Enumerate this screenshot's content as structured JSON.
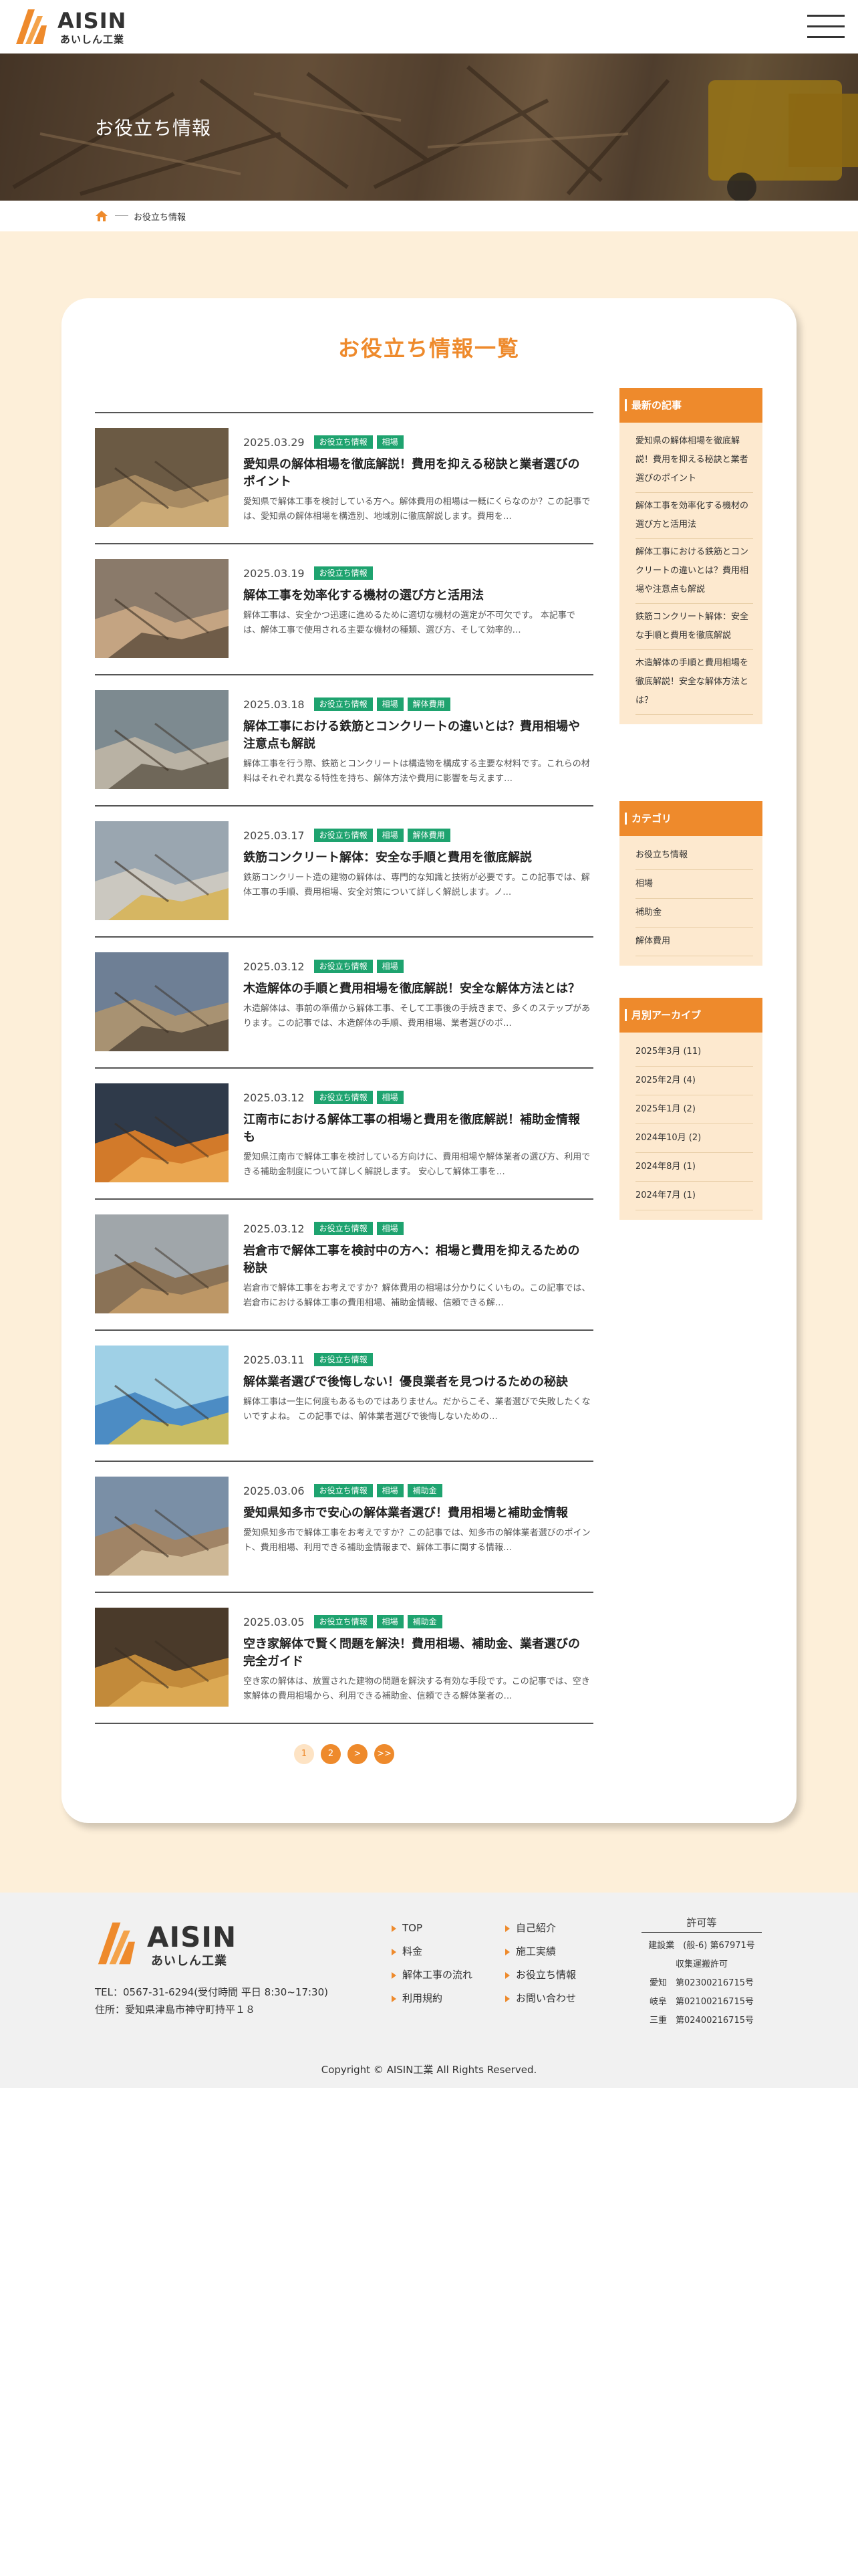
{
  "header": {
    "logo_en": "AISIN",
    "logo_jp": "あいしん工業"
  },
  "hero": {
    "title": "お役立ち情報"
  },
  "breadcrumb": {
    "current": "お役立ち情報"
  },
  "main": {
    "title": "お役立ち情報一覧",
    "articles": [
      {
        "date": "2025.03.29",
        "tags": [
          "お役立ち情報",
          "相場"
        ],
        "title": "愛知県の解体相場を徹底解説！費用を抑える秘訣と業者選びのポイント",
        "excerpt": "愛知県で解体工事を検討している方へ。解体費用の相場は一概にくらなのか？この記事では、愛知県の解体相場を構造別、地域別に徹底解説します。費用を…"
      },
      {
        "date": "2025.03.19",
        "tags": [
          "お役立ち情報"
        ],
        "title": "解体工事を効率化する機材の選び方と活用法",
        "excerpt": "解体工事は、安全かつ迅速に進めるために適切な機材の選定が不可欠です。 本記事では、解体工事で使用される主要な機材の種類、選び方、そして効率的…"
      },
      {
        "date": "2025.03.18",
        "tags": [
          "お役立ち情報",
          "相場",
          "解体費用"
        ],
        "title": "解体工事における鉄筋とコンクリートの違いとは？費用相場や注意点も解説",
        "excerpt": "解体工事を行う際、鉄筋とコンクリートは構造物を構成する主要な材料です。これらの材料はそれぞれ異なる特性を持ち、解体方法や費用に影響を与えます…"
      },
      {
        "date": "2025.03.17",
        "tags": [
          "お役立ち情報",
          "相場",
          "解体費用"
        ],
        "title": "鉄筋コンクリート解体：安全な手順と費用を徹底解説",
        "excerpt": "鉄筋コンクリート造の建物の解体は、専門的な知識と技術が必要です。この記事では、解体工事の手順、費用相場、安全対策について詳しく解説します。ノ…"
      },
      {
        "date": "2025.03.12",
        "tags": [
          "お役立ち情報",
          "相場"
        ],
        "title": "木造解体の手順と費用相場を徹底解説！安全な解体方法とは？",
        "excerpt": "木造解体は、事前の準備から解体工事、そして工事後の手続きまで、多くのステップがあります。この記事では、木造解体の手順、費用相場、業者選びのポ…"
      },
      {
        "date": "2025.03.12",
        "tags": [
          "お役立ち情報",
          "相場"
        ],
        "title": "江南市における解体工事の相場と費用を徹底解説！補助金情報も",
        "excerpt": "愛知県江南市で解体工事を検討している方向けに、費用相場や解体業者の選び方、利用できる補助金制度について詳しく解説します。 安心して解体工事を…"
      },
      {
        "date": "2025.03.12",
        "tags": [
          "お役立ち情報",
          "相場"
        ],
        "title": "岩倉市で解体工事を検討中の方へ：相場と費用を抑えるための秘訣",
        "excerpt": "岩倉市で解体工事をお考えですか？解体費用の相場は分かりにくいもの。この記事では、岩倉市における解体工事の費用相場、補助金情報、信頼できる解…"
      },
      {
        "date": "2025.03.11",
        "tags": [
          "お役立ち情報"
        ],
        "title": "解体業者選びで後悔しない！優良業者を見つけるための秘訣",
        "excerpt": "解体工事は一生に何度もあるものではありません。だからこそ、業者選びで失敗したくないですよね。 この記事では、解体業者選びで後悔しないための…"
      },
      {
        "date": "2025.03.06",
        "tags": [
          "お役立ち情報",
          "相場",
          "補助金"
        ],
        "title": "愛知県知多市で安心の解体業者選び！費用相場と補助金情報",
        "excerpt": "愛知県知多市で解体工事をお考えですか？この記事では、知多市の解体業者選びのポイント、費用相場、利用できる補助金情報まで、解体工事に関する情報…"
      },
      {
        "date": "2025.03.05",
        "tags": [
          "お役立ち情報",
          "相場",
          "補助金"
        ],
        "title": "空き家解体で賢く問題を解決！費用相場、補助金、業者選びの完全ガイド",
        "excerpt": "空き家の解体は、放置された建物の問題を解決する有効な手段です。この記事では、空き家解体の費用相場から、利用できる補助金、信頼できる解体業者の…"
      }
    ],
    "pagination": [
      "1",
      "2",
      ">",
      ">>"
    ]
  },
  "sidebar": {
    "recent_title": "最新の記事",
    "recent": [
      "愛知県の解体相場を徹底解説！費用を抑える秘訣と業者選びのポイント",
      "解体工事を効率化する機材の選び方と活用法",
      "解体工事における鉄筋とコンクリートの違いとは？費用相場や注意点も解説",
      "鉄筋コンクリート解体：安全な手順と費用を徹底解説",
      "木造解体の手順と費用相場を徹底解説！安全な解体方法とは？"
    ],
    "category_title": "カテゴリ",
    "categories": [
      "お役立ち情報",
      "相場",
      "補助金",
      "解体費用"
    ],
    "archive_title": "月別アーカイブ",
    "archives": [
      "2025年3月 (11)",
      "2025年2月 (4)",
      "2025年1月 (2)",
      "2024年10月 (2)",
      "2024年8月 (1)",
      "2024年7月 (1)"
    ]
  },
  "footer": {
    "logo_en": "AISIN",
    "logo_jp": "あいしん工業",
    "tel": "TEL：0567-31-6294(受付時間 平日 8:30~17:30)",
    "address": "住所：愛知県津島市神守町持平１８",
    "nav_col1": [
      "TOP",
      "料金",
      "解体工事の流れ",
      "利用規約"
    ],
    "nav_col2": [
      "自己紹介",
      "施工実績",
      "お役立ち情報",
      "お問い合わせ"
    ],
    "license_title": "許可等",
    "license_lines": [
      "建設業　(般-6) 第67971号",
      "収集運搬許可",
      "愛知　第02300216715号",
      "岐阜　第02100216715号",
      "三重　第02400216715号"
    ],
    "copyright": "Copyright © AISIN工業 All Rights Reserved."
  },
  "colors": {
    "accent": "#ee8a2c",
    "tag_green": "#1ea36f",
    "main_bg": "#fdefd9",
    "widget_bg": "#fde9cf"
  }
}
